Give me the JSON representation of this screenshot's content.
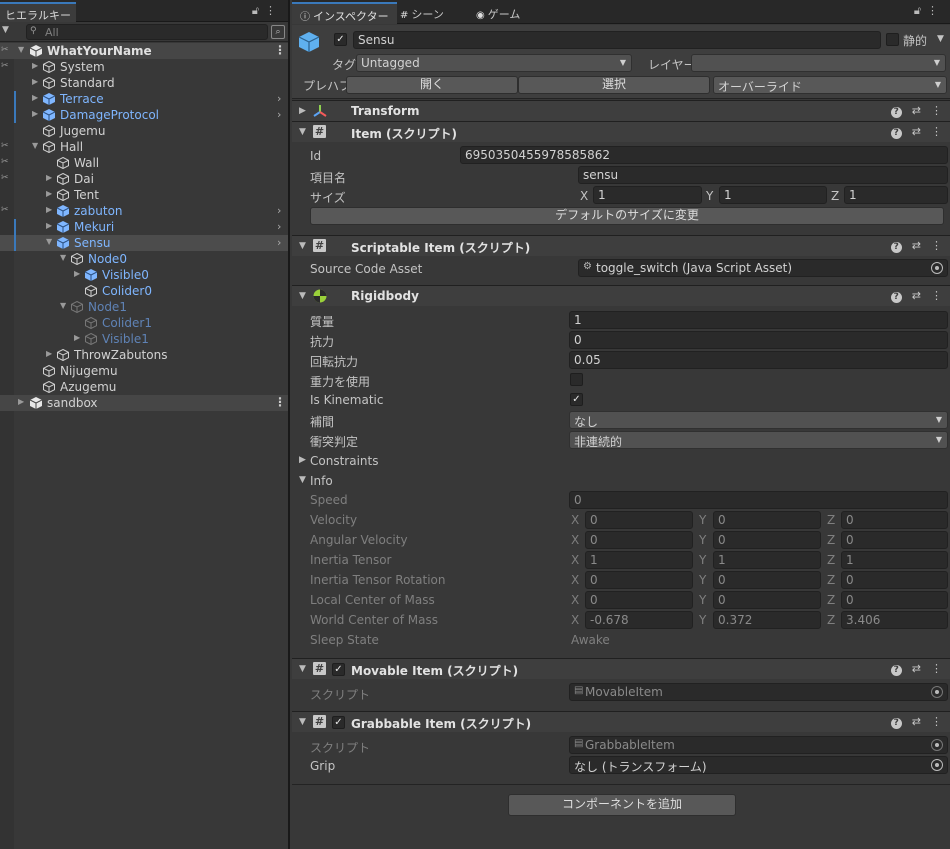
{
  "hierarchy": {
    "tab_label": "ヒエラルキー",
    "search_placeholder": "All",
    "rows": [
      {
        "label": "WhatYourName",
        "style": "scene"
      },
      {
        "label": "System",
        "style": "white"
      },
      {
        "label": "Standard",
        "style": "white"
      },
      {
        "label": "Terrace",
        "style": "blue"
      },
      {
        "label": "DamageProtocol",
        "style": "blue"
      },
      {
        "label": "Jugemu",
        "style": "white"
      },
      {
        "label": "Hall",
        "style": "white"
      },
      {
        "label": "Wall",
        "style": "white"
      },
      {
        "label": "Dai",
        "style": "white"
      },
      {
        "label": "Tent",
        "style": "white"
      },
      {
        "label": "zabuton",
        "style": "blue"
      },
      {
        "label": "Mekuri",
        "style": "blue"
      },
      {
        "label": "Sensu",
        "style": "blue"
      },
      {
        "label": "Node0",
        "style": "blue"
      },
      {
        "label": "Visible0",
        "style": "blue"
      },
      {
        "label": "Colider0",
        "style": "blue"
      },
      {
        "label": "Node1",
        "style": "dim"
      },
      {
        "label": "Colider1",
        "style": "dim"
      },
      {
        "label": "Visible1",
        "style": "dim"
      },
      {
        "label": "ThrowZabutons",
        "style": "white"
      },
      {
        "label": "Nijugemu",
        "style": "white"
      },
      {
        "label": "Azugemu",
        "style": "white"
      },
      {
        "label": "sandbox",
        "style": "scene"
      }
    ]
  },
  "inspector": {
    "tabs": [
      "インスペクター",
      "シーン",
      "ゲーム"
    ],
    "object": {
      "name": "Sensu",
      "static_label": "静的",
      "tag_label": "タグ",
      "tag_value": "Untagged",
      "layer_label": "レイヤー",
      "layer_value": "",
      "prefab_label": "プレハブ",
      "prefab_open": "開く",
      "prefab_select": "選択",
      "prefab_overrides": "オーバーライド"
    },
    "transform": {
      "title": "Transform"
    },
    "item": {
      "title": "Item (スクリプト)",
      "id_label": "Id",
      "id_value": "6950350455978585862",
      "name_label": "項目名",
      "name_value": "sensu",
      "size_label": "サイズ",
      "size_x": "1",
      "size_y": "1",
      "size_z": "1",
      "reset_button": "デフォルトのサイズに変更"
    },
    "scriptable": {
      "title": "Scriptable Item (スクリプト)",
      "source_label": "Source Code Asset",
      "source_value": "toggle_switch (Java Script Asset)"
    },
    "rigidbody": {
      "title": "Rigidbody",
      "mass_label": "質量",
      "mass_value": "1",
      "drag_label": "抗力",
      "drag_value": "0",
      "angular_drag_label": "回転抗力",
      "angular_drag_value": "0.05",
      "gravity_label": "重力を使用",
      "kinematic_label": "Is Kinematic",
      "interp_label": "補間",
      "interp_value": "なし",
      "collision_label": "衝突判定",
      "collision_value": "非連続的",
      "constraints_label": "Constraints",
      "info_label": "Info",
      "speed_label": "Speed",
      "speed_value": "0",
      "velocity_label": "Velocity",
      "velocity": [
        "0",
        "0",
        "0"
      ],
      "angular_velocity_label": "Angular Velocity",
      "angular_velocity": [
        "0",
        "0",
        "0"
      ],
      "inertia_tensor_label": "Inertia Tensor",
      "inertia_tensor": [
        "1",
        "1",
        "1"
      ],
      "inertia_rot_label": "Inertia Tensor Rotation",
      "inertia_rot": [
        "0",
        "0",
        "0"
      ],
      "local_com_label": "Local Center of Mass",
      "local_com": [
        "0",
        "0",
        "0"
      ],
      "world_com_label": "World Center of Mass",
      "world_com": [
        "-0.678",
        "0.372",
        "3.406"
      ],
      "sleep_label": "Sleep State",
      "sleep_value": "Awake"
    },
    "movable": {
      "title": "Movable Item (スクリプト)",
      "script_label": "スクリプト",
      "script_value": "MovableItem"
    },
    "grabbable": {
      "title": "Grabbable Item (スクリプト)",
      "script_label": "スクリプト",
      "script_value": "GrabbableItem",
      "grip_label": "Grip",
      "grip_value": "なし (トランスフォーム)"
    },
    "add_component": "コンポーネントを追加",
    "axis_labels": [
      "X",
      "Y",
      "Z"
    ]
  },
  "colors": {
    "accent": "#3a79bb",
    "prefab_blue": "#7fb6ff",
    "panel": "#383838"
  }
}
